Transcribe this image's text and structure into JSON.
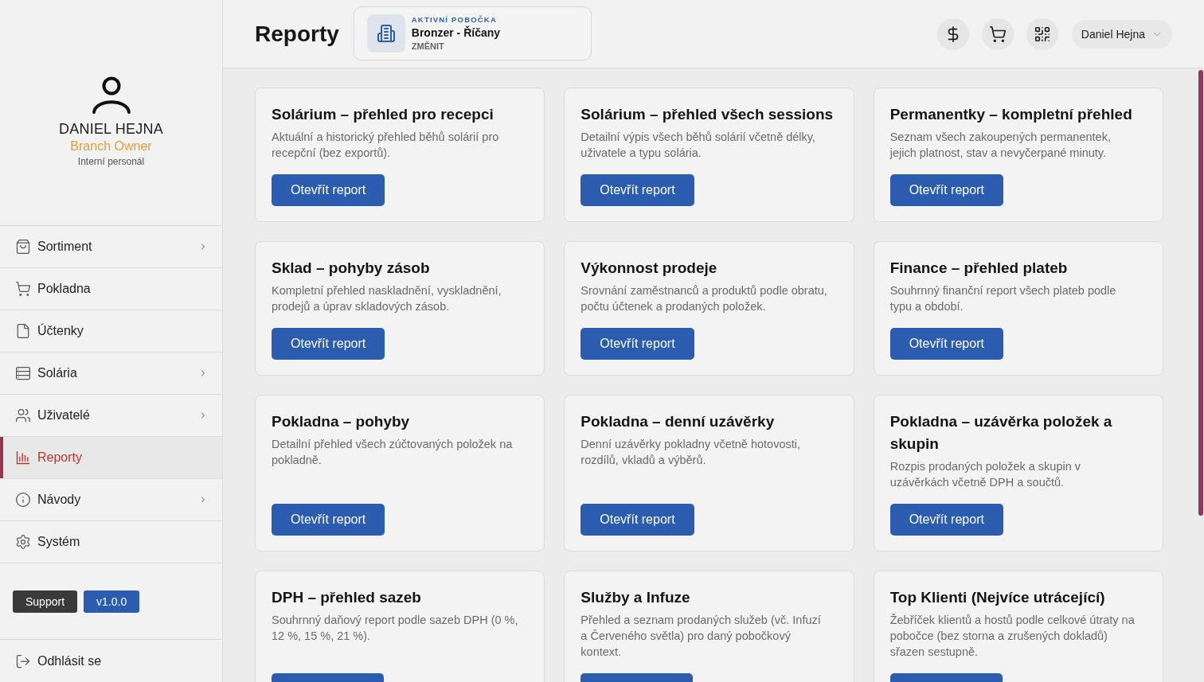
{
  "sidebar": {
    "profile": {
      "name": "DANIEL HEJNA",
      "role": "Branch Owner",
      "group": "Interní personál"
    },
    "menu": [
      {
        "label": "Sortiment",
        "submenu": true,
        "selected": false
      },
      {
        "label": "Pokladna",
        "submenu": false,
        "selected": false
      },
      {
        "label": "Účtenky",
        "submenu": false,
        "selected": false
      },
      {
        "label": "Solária",
        "submenu": true,
        "selected": false
      },
      {
        "label": "Uživatelé",
        "submenu": true,
        "selected": false
      },
      {
        "label": "Reporty",
        "submenu": false,
        "selected": true
      },
      {
        "label": "Návody",
        "submenu": true,
        "selected": false
      },
      {
        "label": "Systém",
        "submenu": false,
        "selected": false
      }
    ],
    "support_button": "Support",
    "version": "v1.0.0",
    "logout": "Odhlásit se"
  },
  "header": {
    "title": "Reporty",
    "branch": {
      "caption": "AKTIVNÍ POBOČKA",
      "name": "Bronzer - Říčany",
      "action": "ZMĚNIT"
    },
    "user_menu": "Daniel Hejna"
  },
  "reports": [
    {
      "title": "Solárium – přehled pro recepci",
      "description": "Aktuální a historický přehled běhů solárií pro recepční (bez exportů).",
      "button": "Otevřít report"
    },
    {
      "title": "Solárium – přehled všech sessions",
      "description": "Detailní výpis všech běhů solárií včetně délky, uživatele a typu solária.",
      "button": "Otevřít report"
    },
    {
      "title": "Permanentky – kompletní přehled",
      "description": "Seznam všech zakoupených permanentek, jejich platnost, stav a nevyčerpané minuty.",
      "button": "Otevřít report"
    },
    {
      "title": "Sklad – pohyby zásob",
      "description": "Kompletní přehled naskladnění, vyskladnění, prodejů a úprav skladových zásob.",
      "button": "Otevřít report"
    },
    {
      "title": "Výkonnost prodeje",
      "description": "Srovnání zaměstnanců a produktů podle obratu, počtu účtenek a prodaných položek.",
      "button": "Otevřít report"
    },
    {
      "title": "Finance – přehled plateb",
      "description": "Souhrnný finanční report všech plateb podle typu a období.",
      "button": "Otevřít report"
    },
    {
      "title": "Pokladna – pohyby",
      "description": "Detailní přehled všech zúčtovaných položek na pokladně.",
      "button": "Otevřít report"
    },
    {
      "title": "Pokladna – denní uzávěrky",
      "description": "Denní uzávěrky pokladny včetně hotovosti, rozdílů, vkladů a výběrů.",
      "button": "Otevřít report"
    },
    {
      "title": "Pokladna – uzávěrka položek a skupin",
      "description": "Rozpis prodaných položek a skupin v uzávěrkách včetně DPH a součtů.",
      "button": "Otevřít report"
    },
    {
      "title": "DPH – přehled sazeb",
      "description": "Souhrnný daňový report podle sazeb DPH (0 %, 12 %, 15 %, 21 %)."
    },
    {
      "title": "Služby a Infuze",
      "description": "Přehled a seznam prodaných služeb (vč. Infuzí a Červeného světla) pro daný pobočkový kontext."
    },
    {
      "title": "Top Klienti (Nejvíce utrácející)",
      "description": "Žebříček klientů a hostů podle celkové útraty na pobočce (bez storna a zrušených dokladů) sřazen sestupně."
    }
  ]
}
